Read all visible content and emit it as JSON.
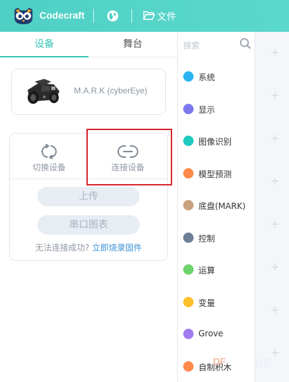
{
  "header": {
    "brand": "Codecraft",
    "file_label": "文件"
  },
  "tabs": [
    {
      "label": "设备",
      "active": true
    },
    {
      "label": "舞台",
      "active": false
    }
  ],
  "device": {
    "name": "M.A.R.K (cyberEye)"
  },
  "actions": {
    "switch_label": "切换设备",
    "connect_label": "连接设备"
  },
  "buttons": {
    "upload": "上传",
    "serial_chart": "串口图表"
  },
  "help": {
    "text": "无法连接成功?",
    "link": "立即烧录固件"
  },
  "search": {
    "placeholder": "搜索"
  },
  "categories": [
    {
      "label": "系统",
      "color": "#2bb5f0"
    },
    {
      "label": "显示",
      "color": "#7b79ee"
    },
    {
      "label": "图像识别",
      "color": "#1fc9c0"
    },
    {
      "label": "模型预测",
      "color": "#ff8a4a"
    },
    {
      "label": "底盘(MARK)",
      "color": "#c9a27e"
    },
    {
      "label": "控制",
      "color": "#6f7f97"
    },
    {
      "label": "运算",
      "color": "#6dd36b"
    },
    {
      "label": "变量",
      "color": "#ffc02e"
    },
    {
      "label": "Grove",
      "color": "#a27bf0"
    },
    {
      "label": "自制积木",
      "color": "#ff8a4a"
    }
  ],
  "watermark": {
    "brand": "DF",
    "suffix": "社区"
  },
  "colors": {
    "accent": "#38c4b8",
    "header": "#4fd0c4",
    "highlight": "#d8232a",
    "link": "#3a8fd6"
  }
}
